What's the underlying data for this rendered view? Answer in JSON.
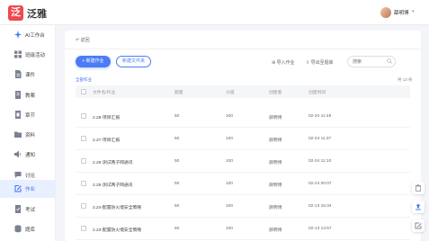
{
  "header": {
    "logo_glyph": "泛",
    "brand": "泛雅",
    "user": "薛明博",
    "caret": "▾"
  },
  "sidebar": {
    "items": [
      {
        "label": "AI工作台",
        "icon": "sparkle-icon"
      },
      {
        "label": "班级活动",
        "icon": "grid-icon"
      },
      {
        "label": "课件",
        "icon": "document-icon"
      },
      {
        "label": "教案",
        "icon": "book-icon"
      },
      {
        "label": "章节",
        "icon": "chapter-icon"
      },
      {
        "label": "资料",
        "icon": "folder-icon"
      },
      {
        "label": "通知",
        "icon": "speaker-icon"
      },
      {
        "label": "讨论",
        "icon": "chat-icon"
      },
      {
        "label": "作业",
        "icon": "edit-icon"
      },
      {
        "label": "考试",
        "icon": "exam-icon"
      },
      {
        "label": "题库",
        "icon": "database-icon"
      }
    ],
    "active_index": 8
  },
  "main": {
    "back": "返回",
    "new_homework": "+ 新建作业",
    "new_folder": "新建文件夹",
    "import": "导入作业",
    "export": "导出至题库",
    "search_placeholder": "搜索",
    "all_homework": "全部作业",
    "total": "共 13 条",
    "columns": [
      "文件名/作业",
      "题量",
      "分值",
      "创建者",
      "创建时间"
    ],
    "rows": [
      {
        "name": "2.28-项目汇报",
        "count": "50",
        "score": "100",
        "creator": "薛明博",
        "time": "02-24 11:49"
      },
      {
        "name": "2.27-项目汇报",
        "count": "50",
        "score": "100",
        "creator": "薛明博",
        "time": "02-24 11:37"
      },
      {
        "name": "2.26-测试两子网通讯",
        "count": "50",
        "score": "100",
        "creator": "薛明博",
        "time": "02-24 11:10"
      },
      {
        "name": "2.25-测试两子网通讯",
        "count": "50",
        "score": "100",
        "creator": "薛明博",
        "time": "02-24 00:07"
      },
      {
        "name": "2.24-配置防火墙安全策略",
        "count": "50",
        "score": "100",
        "creator": "薛明博",
        "time": "02-13 15:34"
      },
      {
        "name": "2.23-配置防火墙安全策略",
        "count": "50",
        "score": "100",
        "creator": "薛明博",
        "time": "02-13 14:57"
      }
    ]
  },
  "colors": {
    "accent": "#4a7cf6",
    "brand_red": "#f0484e",
    "active_bg": "#e8efff"
  },
  "float_tools": [
    "trash-icon",
    "upload-icon",
    "edit-icon"
  ]
}
